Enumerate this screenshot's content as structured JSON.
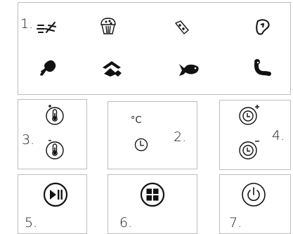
{
  "panels": {
    "food_programs": {
      "number": "1.",
      "icons": [
        "defrost-icon",
        "baking-icon",
        "cheese-icon",
        "steak-icon",
        "chicken-leg-icon",
        "vegetables-icon",
        "fish-icon",
        "sausage-icon"
      ]
    },
    "temperature": {
      "number": "3.",
      "icons": [
        "temp-up-icon",
        "temp-down-icon"
      ]
    },
    "display": {
      "number": "2.",
      "unit_label": "°C",
      "icons": [
        "clock-icon"
      ]
    },
    "time": {
      "number": "4.",
      "icons": [
        "time-up-icon",
        "time-down-icon"
      ]
    },
    "start_pause": {
      "number": "5.",
      "icons": [
        "play-pause-icon"
      ]
    },
    "menu": {
      "number": "6.",
      "icons": [
        "menu-grid-icon"
      ]
    },
    "power": {
      "number": "7.",
      "icons": [
        "power-icon"
      ]
    }
  }
}
